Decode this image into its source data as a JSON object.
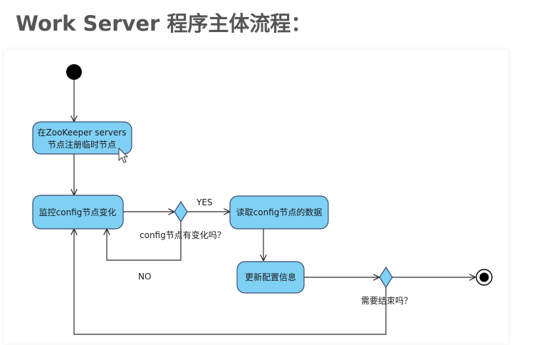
{
  "title": "Work Server 程序主体流程：",
  "colors": {
    "node_fill": "#7fd0f5",
    "node_stroke": "#3a4b6e",
    "line": "#2b2b2b",
    "title": "#555555"
  },
  "nodes": {
    "register": {
      "line1": "在ZooKeeper servers",
      "line2": "节点注册临时节点"
    },
    "watch": {
      "label": "监控config节点变化"
    },
    "read": {
      "label": "读取config节点的数据"
    },
    "update": {
      "label": "更新配置信息"
    }
  },
  "decisions": {
    "config_changed": {
      "question": "config节点有变化吗？"
    },
    "need_end": {
      "question": "需要结束吗？"
    }
  },
  "edges": {
    "yes_label": "YES",
    "no_label": "NO"
  }
}
